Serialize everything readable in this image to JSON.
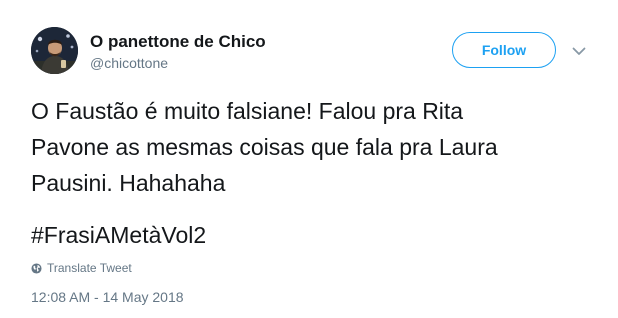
{
  "author": {
    "display_name": "O panettone de Chico",
    "handle": "@chicottone",
    "avatar_icon": "profile-photo"
  },
  "actions": {
    "follow_label": "Follow",
    "more_icon": "chevron-down-icon"
  },
  "tweet": {
    "lines": [
      "O Faustão é muito falsiane! Falou pra Rita",
      "Pavone as mesmas coisas que fala pra Laura",
      "Pausini. Hahahaha"
    ],
    "hashtag": "#FrasiAMetàVol2"
  },
  "translate": {
    "icon": "globe-icon",
    "label": "Translate Tweet"
  },
  "meta": {
    "timestamp": "12:08 AM - 14 May 2018"
  },
  "colors": {
    "accent": "#1da1f2",
    "text_primary": "#14171a",
    "text_secondary": "#657786"
  }
}
